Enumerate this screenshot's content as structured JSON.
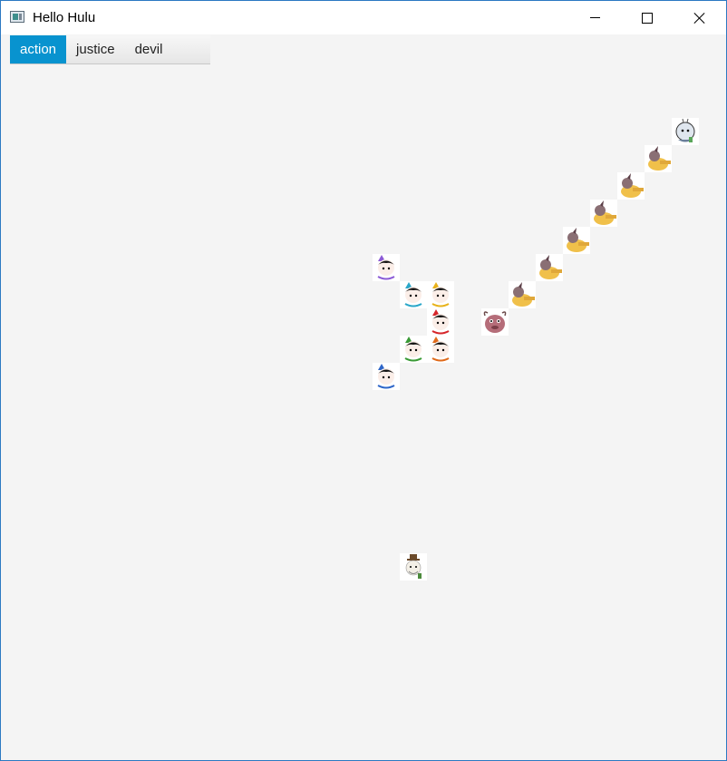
{
  "window": {
    "title": "Hello Hulu"
  },
  "titlebar_icons": {
    "app": "app-window-icon",
    "minimize": "minimize-icon",
    "maximize": "maximize-icon",
    "close": "close-icon"
  },
  "menu": {
    "items": [
      "action",
      "justice",
      "devil"
    ],
    "active": "action"
  },
  "colors": {
    "accent": "#0893cf",
    "window_border": "#2b79c2",
    "background": "#f4f4f4",
    "gourd_hats": [
      "#8c5bd6",
      "#2aa7c9",
      "#e8b21a",
      "#d6262b",
      "#3a9a36",
      "#e06a1a",
      "#2e66c8"
    ]
  },
  "board": {
    "sprites": [
      {
        "kind": "grandpa-sprite"
      },
      {
        "kind": "gourd-brother-sprite",
        "color_index": 0
      },
      {
        "kind": "gourd-brother-sprite",
        "color_index": 1
      },
      {
        "kind": "gourd-brother-sprite",
        "color_index": 2
      },
      {
        "kind": "gourd-brother-sprite",
        "color_index": 3
      },
      {
        "kind": "gourd-brother-sprite",
        "color_index": 4
      },
      {
        "kind": "gourd-brother-sprite",
        "color_index": 5
      },
      {
        "kind": "gourd-brother-sprite",
        "color_index": 6
      },
      {
        "kind": "scorpion-demon-sprite"
      },
      {
        "kind": "minion-sprite"
      },
      {
        "kind": "minion-sprite"
      },
      {
        "kind": "minion-sprite"
      },
      {
        "kind": "minion-sprite"
      },
      {
        "kind": "minion-sprite"
      },
      {
        "kind": "minion-sprite"
      },
      {
        "kind": "snake-demon-sprite"
      },
      {
        "kind": "old-man-sprite"
      }
    ]
  }
}
